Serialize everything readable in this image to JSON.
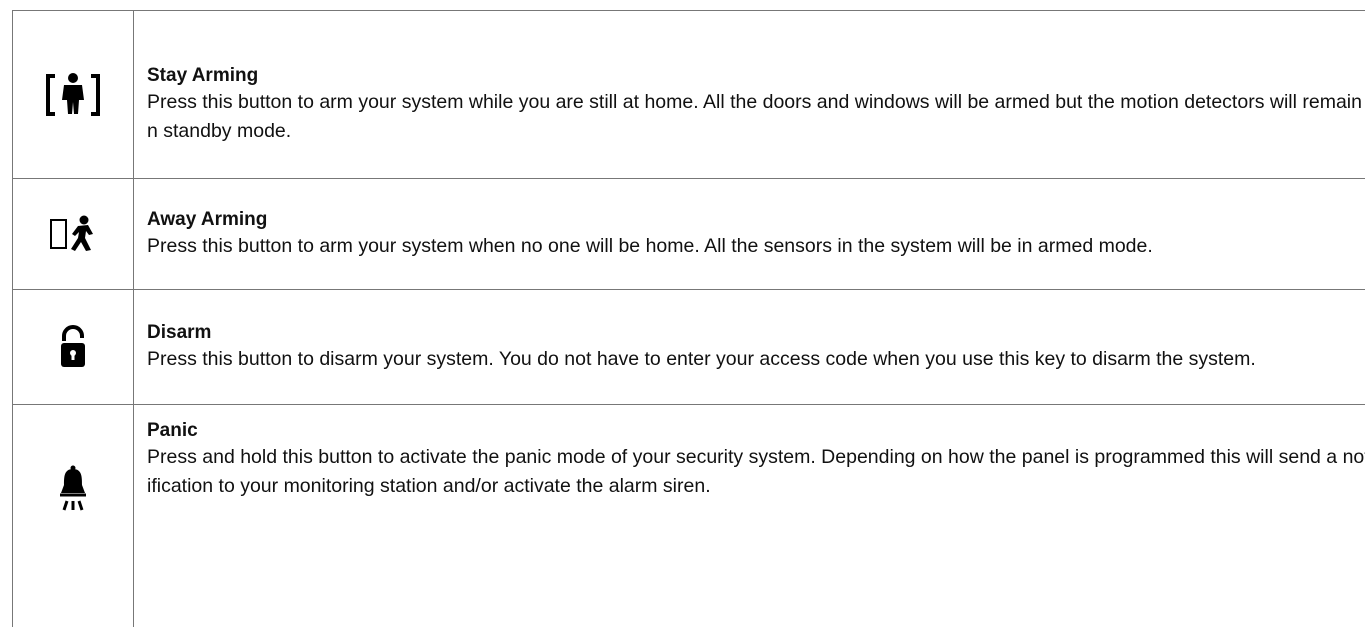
{
  "rows": [
    {
      "icon": "stay-arming-icon",
      "title": "Stay Arming",
      "description": "Press this button to arm your system while you are still at home. All the doors and windows will be armed but the motion detectors will remain in standby mode."
    },
    {
      "icon": "away-arming-icon",
      "title": "Away Arming",
      "description": "Press this button to arm your system when no one will be home. All the sensors in the system will be in armed mode."
    },
    {
      "icon": "unlock-icon",
      "title": "Disarm",
      "description": "Press this button to disarm your system. You do not have to enter your access code when you use this key to disarm the system."
    },
    {
      "icon": "alarm-bell-icon",
      "title": "Panic",
      "description": "Press and hold this button to activate the panic mode of your security system. Depending on how the panel is programmed this will send a notification to your monitoring station and/or activate the alarm siren."
    }
  ]
}
